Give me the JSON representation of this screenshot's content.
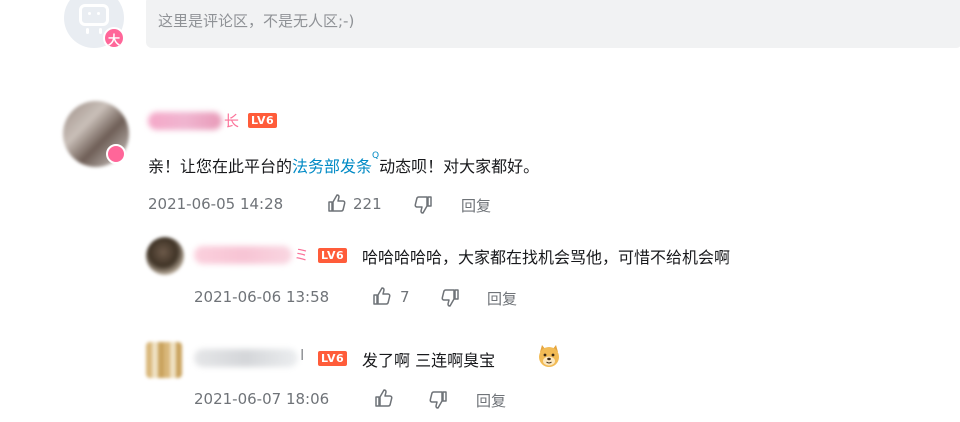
{
  "composer": {
    "placeholder": "这里是评论区，不是无人区;-)",
    "vip_badge": "大"
  },
  "comments": [
    {
      "level": "LV6",
      "name_visible_fragment": "长",
      "content_before_link": "亲！让您在此平台的",
      "link_text": "法务部发条",
      "content_after_link": "动态呗！对大家都好。",
      "timestamp": "2021-06-05 14:28",
      "likes": "221",
      "reply_label": "回复"
    }
  ],
  "replies": [
    {
      "level": "LV6",
      "name_visible_fragment": "ミ",
      "content": "哈哈哈哈哈，大家都在找机会骂他，可惜不给机会啊",
      "timestamp": "2021-06-06 13:58",
      "likes": "7",
      "reply_label": "回复"
    },
    {
      "level": "LV6",
      "name_visible_fragment": "I",
      "content": "发了啊 三连啊臭宝",
      "emoji": "doge-emoji",
      "timestamp": "2021-06-07 18:06",
      "likes": "",
      "reply_label": "回复"
    }
  ],
  "colors": {
    "link": "#008ac5",
    "level_badge": "#ff5c3a",
    "vip_badge": "#ff6699",
    "meta_text": "#6f7378"
  }
}
